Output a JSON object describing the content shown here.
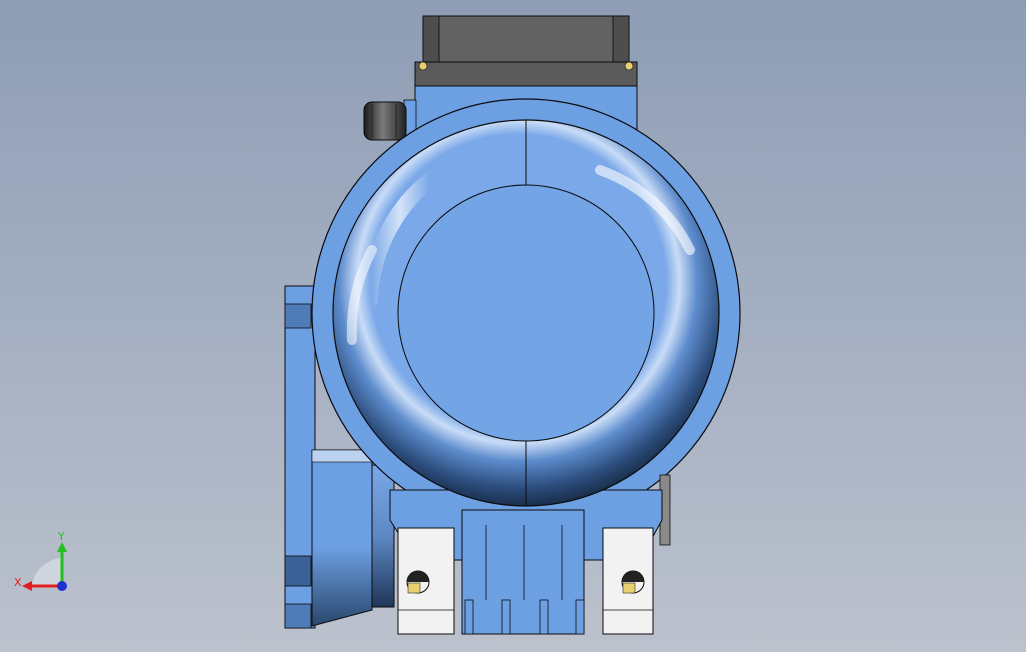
{
  "viewport": {
    "background_top": "#8e9db5",
    "background_bottom": "#bcc2cd"
  },
  "model": {
    "body_color": "#6d9fe3",
    "body_dark": "#2f4f7a",
    "cover_highlight": "#eef5ff",
    "terminal_box_color": "#626262",
    "foot_color": "#f2f2f2",
    "outline_color": "#0b0b0b"
  },
  "triad": {
    "x_label": "X",
    "y_label": "Y",
    "x_color": "#e02020",
    "y_color": "#20c020",
    "z_color": "#2030d0"
  }
}
